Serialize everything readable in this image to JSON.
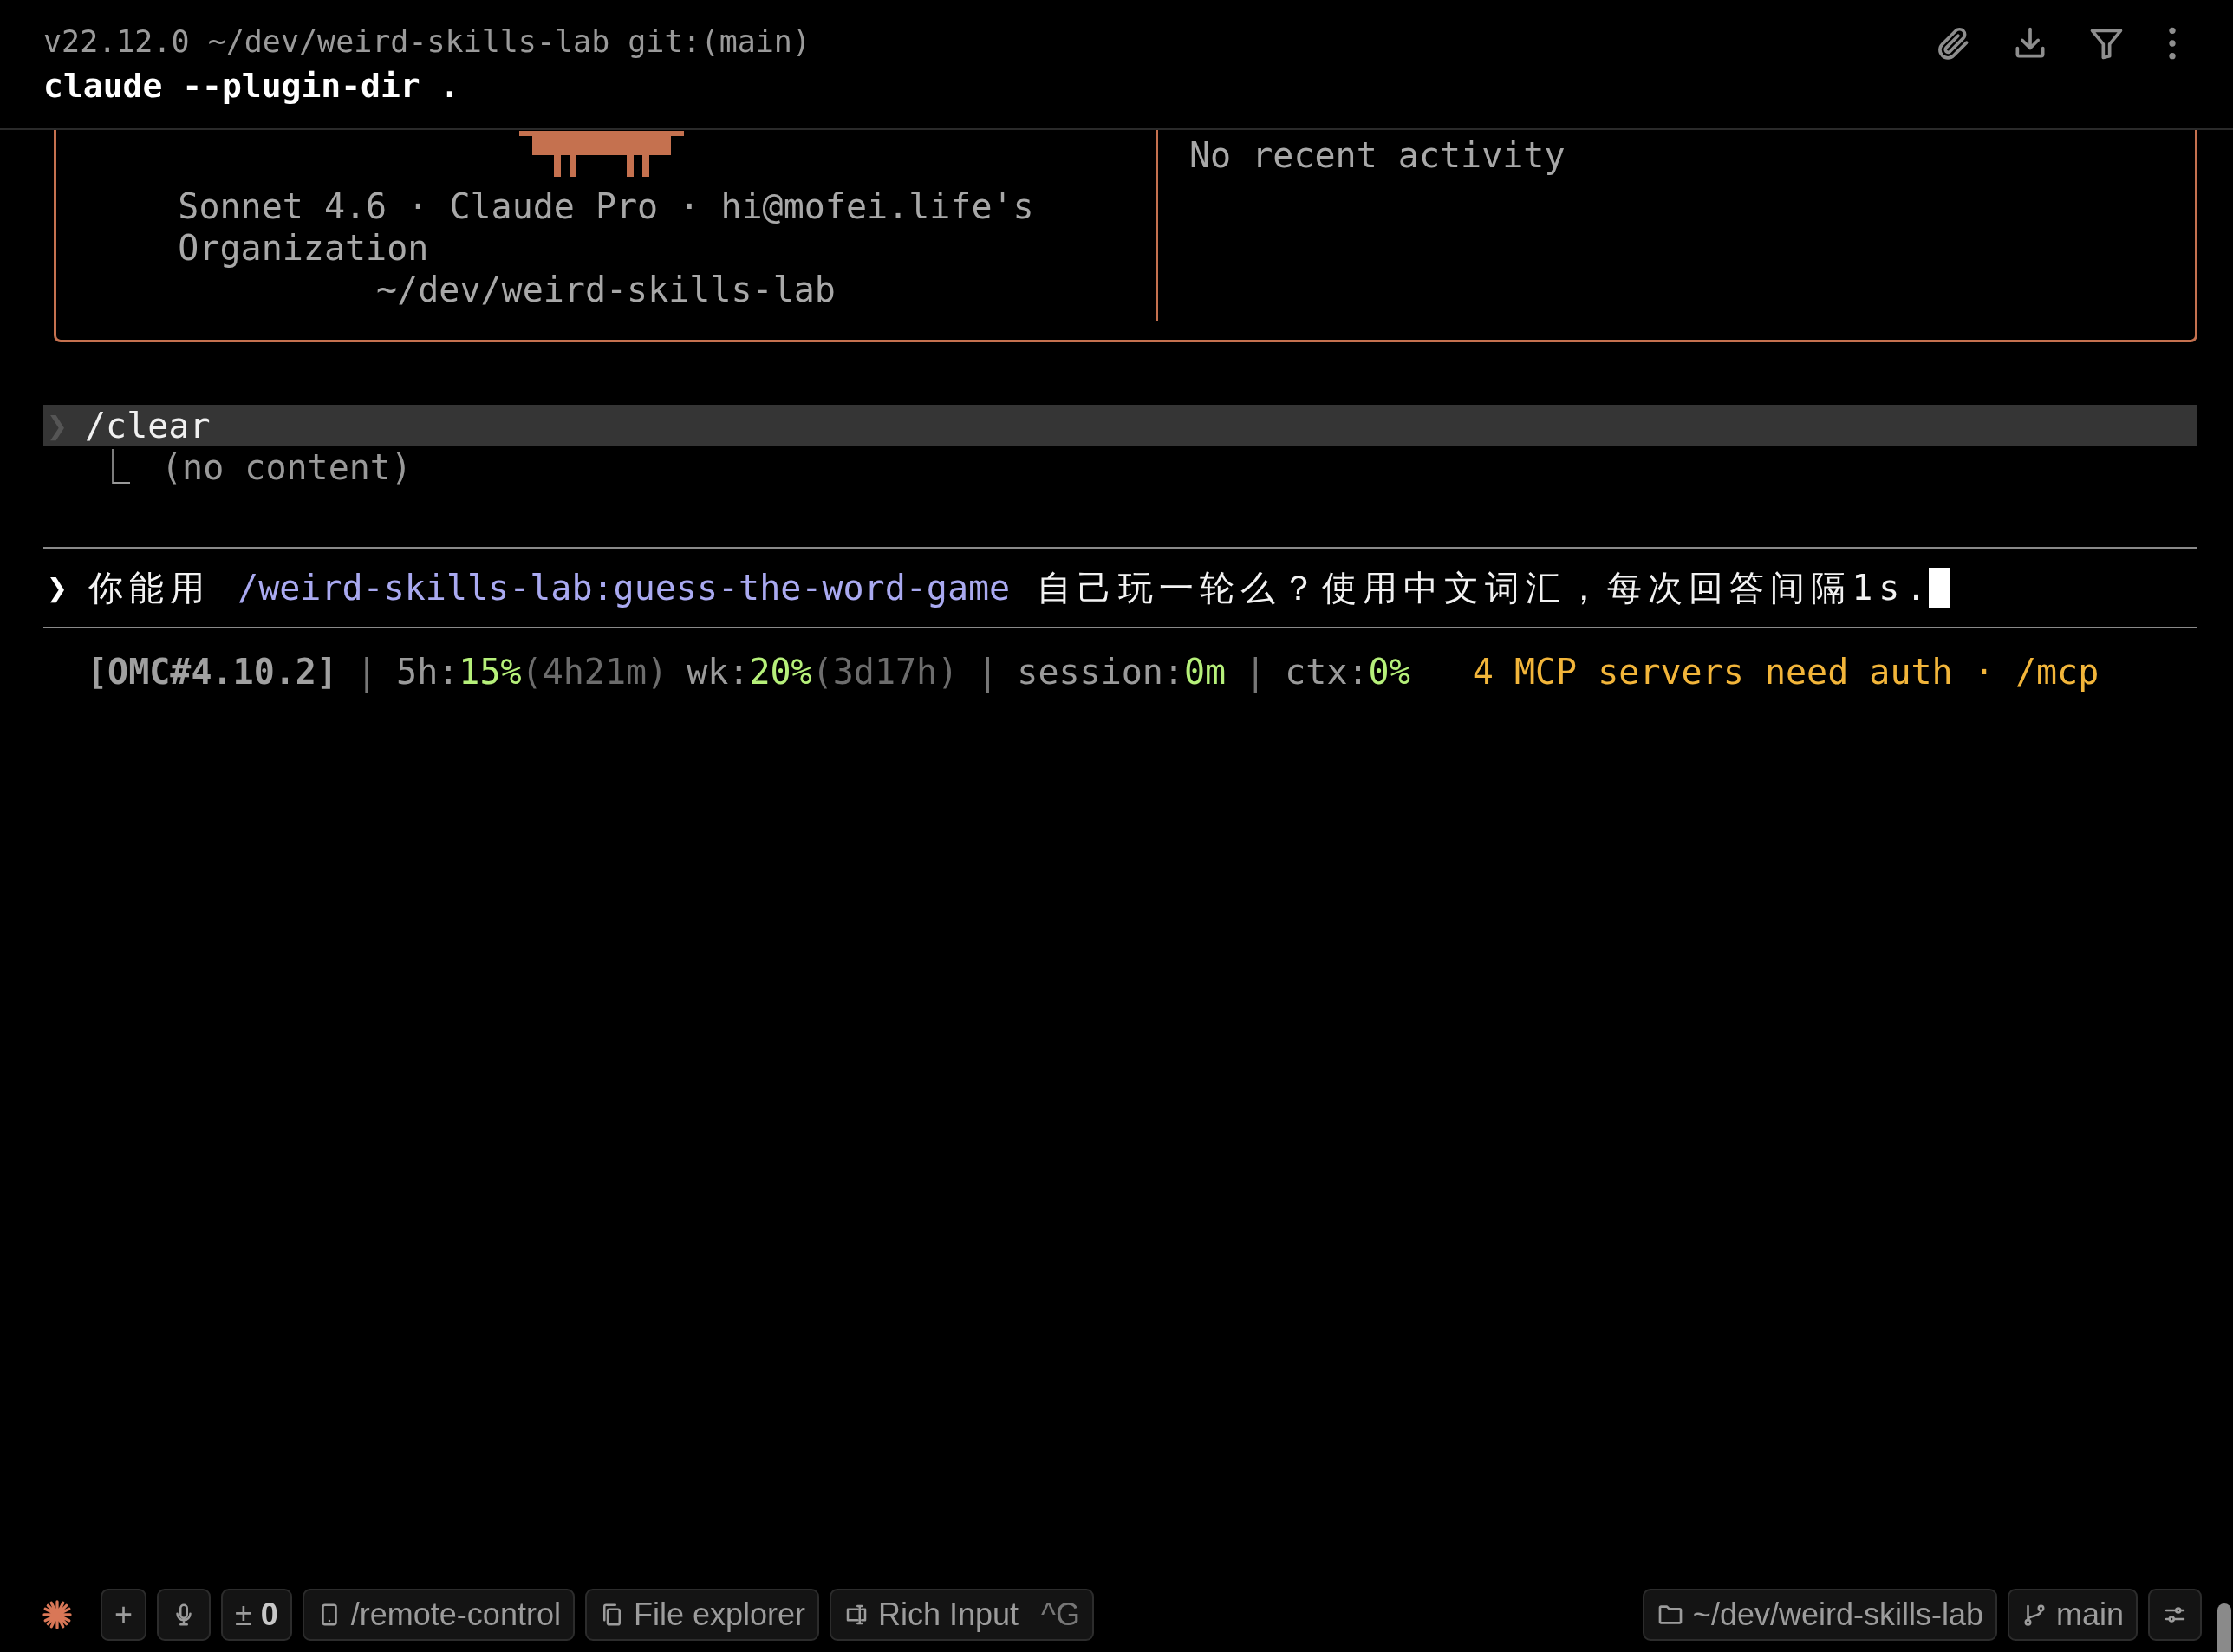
{
  "header": {
    "context_line": "v22.12.0 ~/dev/weird-skills-lab git:(main)",
    "command": "claude --plugin-dir ."
  },
  "welcome_box": {
    "account_line": "Sonnet 4.6 · Claude Pro · hi@mofei.life's Organization",
    "directory": "~/dev/weird-skills-lab",
    "recent_activity": "No recent activity"
  },
  "history": [
    {
      "prompt": "❯",
      "command": "/clear",
      "branch": "⎿",
      "result": "(no content)"
    }
  ],
  "input": {
    "prompt": "❯",
    "segments": [
      {
        "kind": "plain",
        "text": "你能用 "
      },
      {
        "kind": "command",
        "text": "/weird-skills-lab:guess-the-word-game"
      },
      {
        "kind": "plain",
        "text": " 自己玩一轮么？使用中文词汇，每次回答间隔1s."
      }
    ]
  },
  "status_line": {
    "segments": [
      {
        "kind": "tag",
        "text": "[OMC#4.10.2]"
      },
      {
        "kind": "sep",
        "text": "|"
      },
      {
        "kind": "label",
        "text": "5h:"
      },
      {
        "kind": "value",
        "text": "15%"
      },
      {
        "kind": "dim",
        "text": "(4h21m)"
      },
      {
        "kind": "label",
        "text": "wk:"
      },
      {
        "kind": "value",
        "text": "20%"
      },
      {
        "kind": "dim",
        "text": "(3d17h)"
      },
      {
        "kind": "sep",
        "text": "|"
      },
      {
        "kind": "label",
        "text": "session:"
      },
      {
        "kind": "value",
        "text": "0m"
      },
      {
        "kind": "sep",
        "text": "|"
      },
      {
        "kind": "label",
        "text": "ctx:"
      },
      {
        "kind": "value",
        "text": "0%"
      }
    ],
    "notice": "4 MCP servers need auth · /mcp"
  },
  "bottom_bar": {
    "add": "+",
    "changes": "± **0**",
    "remote": "/remote-control",
    "files": "File explorer",
    "rich_input": {
      "label": "Rich Input",
      "shortcut": "^G"
    },
    "folder": "~/dev/weird-skills-lab",
    "branch": "main"
  }
}
